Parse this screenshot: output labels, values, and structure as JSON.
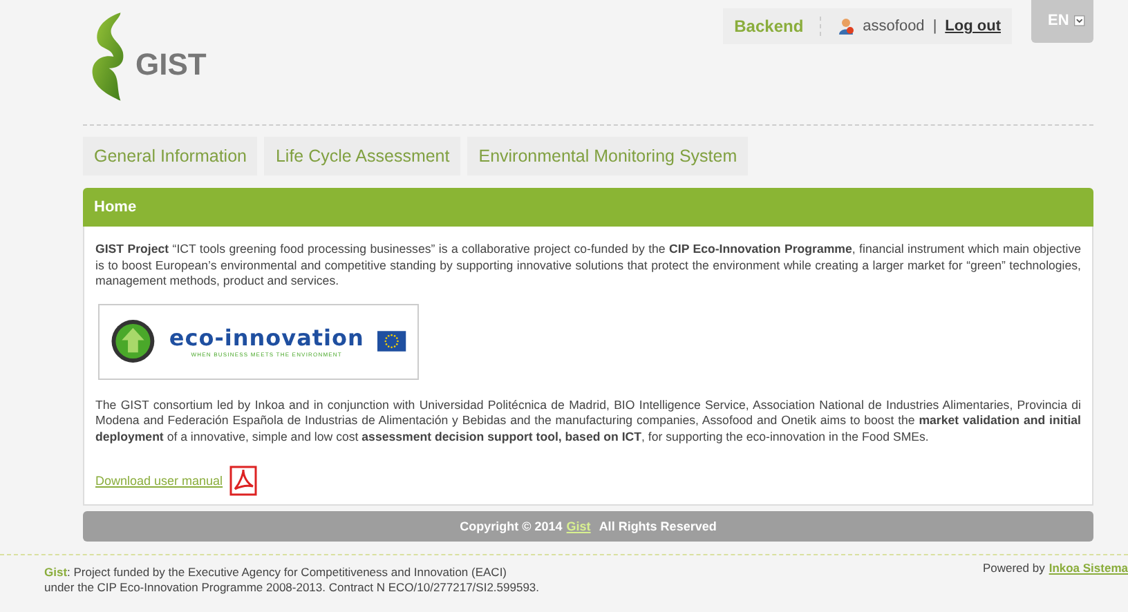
{
  "logo": {
    "text": "GIST"
  },
  "topbar": {
    "backend": "Backend",
    "user": "assofood",
    "separator": "|",
    "logout": "Log out"
  },
  "language": {
    "value": "EN"
  },
  "tabs": [
    {
      "label": "General Information",
      "selected": false
    },
    {
      "label": "Life Cycle Assessment",
      "selected": false
    },
    {
      "label": "Environmental Monitoring System",
      "selected": false
    }
  ],
  "panel": {
    "title": "Home",
    "intro": "**GIST Project** “ICT tools greening food processing businesses” is a collaborative project co-funded by the **CIP Eco-Innovation Programme**, financial instrument which main objective is to boost European’s environmental and competitive standing by supporting innovative solutions that protect the environment while creating a larger market for “green” technologies, management methods, product and services.",
    "banner": {
      "title": "eco-innovation",
      "tagline": "WHEN BUSINESS MEETS THE ENVIRONMENT"
    },
    "consortium": "The GIST consortium led by Inkoa and in conjunction with Universidad Politécnica de Madrid, BIO Intelligence Service, Association National de Industries Alimentaries, Provincia di Modena and Federación Española de Industrias de Alimentación y Bebidas and the manufacturing companies, Assofood and Onetik aims to boost the **market validation and initial deployment** of a innovative, simple and low cost **assessment decision support tool, based on ICT**, for supporting the eco-innovation in the Food SMEs.",
    "download": "Download user manual"
  },
  "copyright": {
    "prefix": "Copyright © 2014",
    "link": "Gist",
    "suffix": "All Rights Reserved"
  },
  "footer": {
    "brand": "Gist",
    "line1": ": Project funded by the Executive Agency for Competitiveness and Innovation (EACI)",
    "line2": "under the CIP Eco-Innovation Programme 2008-2013. Contract N ECO/10/277217/SI2.599593.",
    "powered": "Powered by",
    "powered_link": "Inkoa Sistema"
  }
}
